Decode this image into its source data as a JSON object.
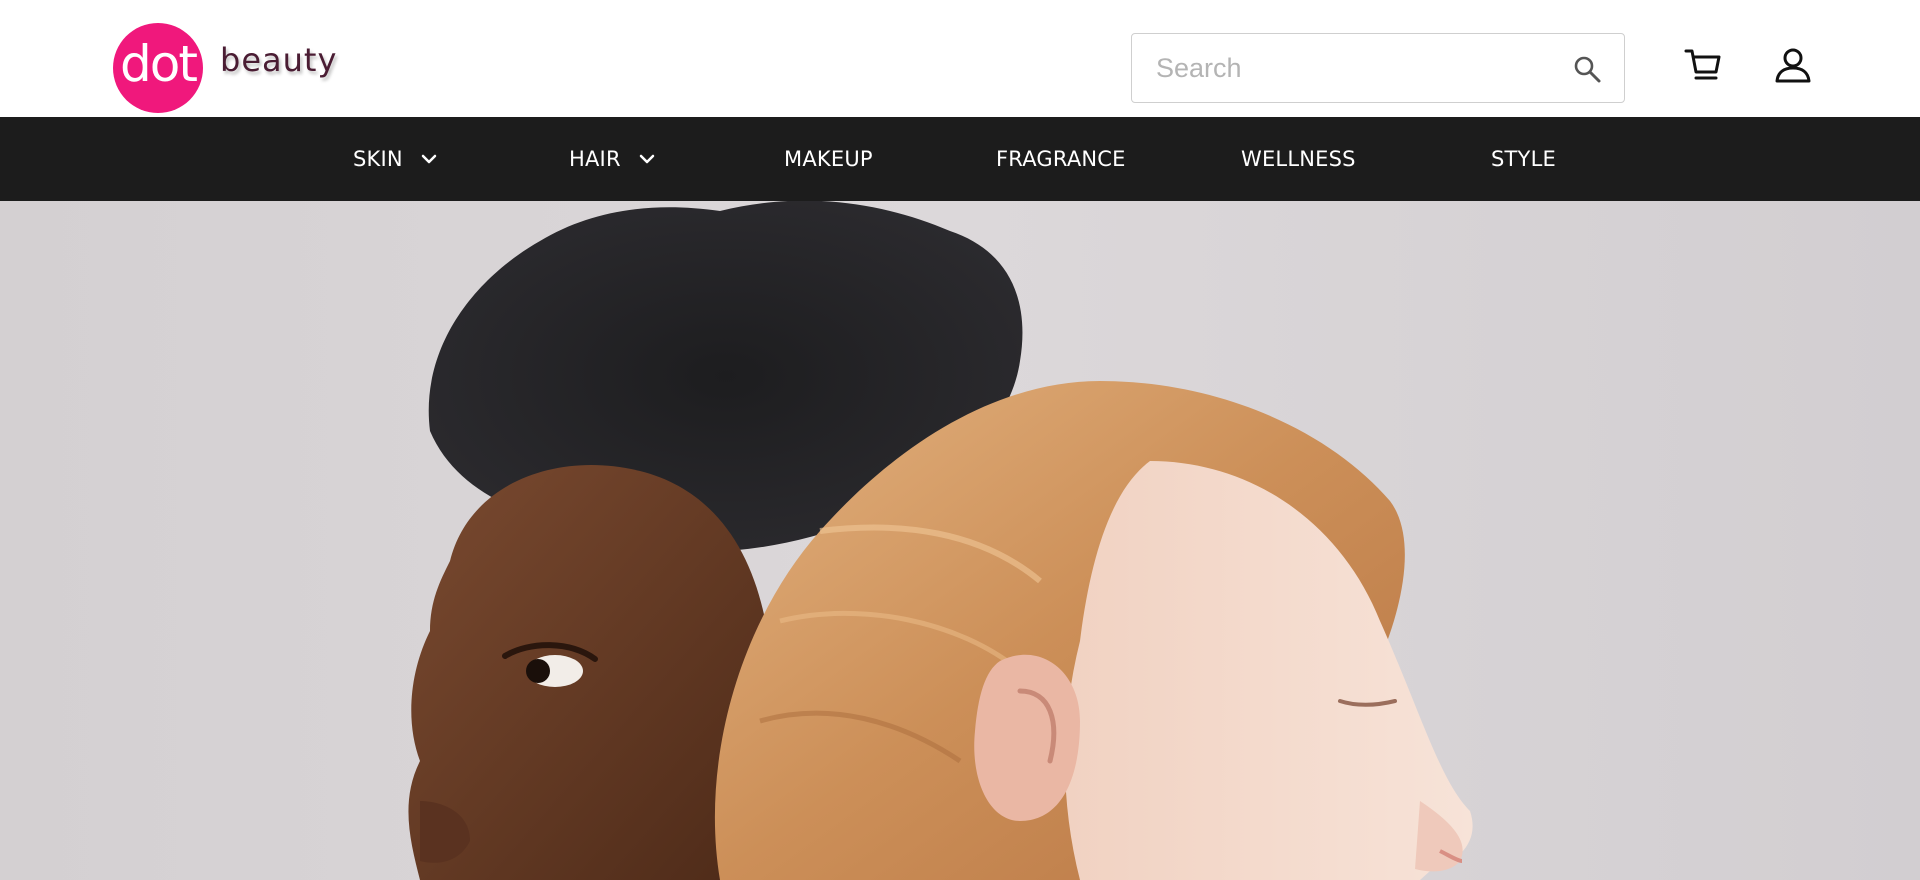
{
  "brand": {
    "logo_mark": "dot",
    "logo_word": "beauty",
    "accent_color": "#f0187c"
  },
  "search": {
    "placeholder": "Search",
    "value": "",
    "icon": "search-icon"
  },
  "header_icons": {
    "cart": "cart-icon",
    "account": "user-icon"
  },
  "nav": {
    "background": "#1c1c1c",
    "items": [
      {
        "label": "SKIN",
        "has_dropdown": true
      },
      {
        "label": "HAIR",
        "has_dropdown": true
      },
      {
        "label": "MAKEUP",
        "has_dropdown": false
      },
      {
        "label": "FRAGRANCE",
        "has_dropdown": false
      },
      {
        "label": "WELLNESS",
        "has_dropdown": false
      },
      {
        "label": "STYLE",
        "has_dropdown": false
      }
    ]
  }
}
